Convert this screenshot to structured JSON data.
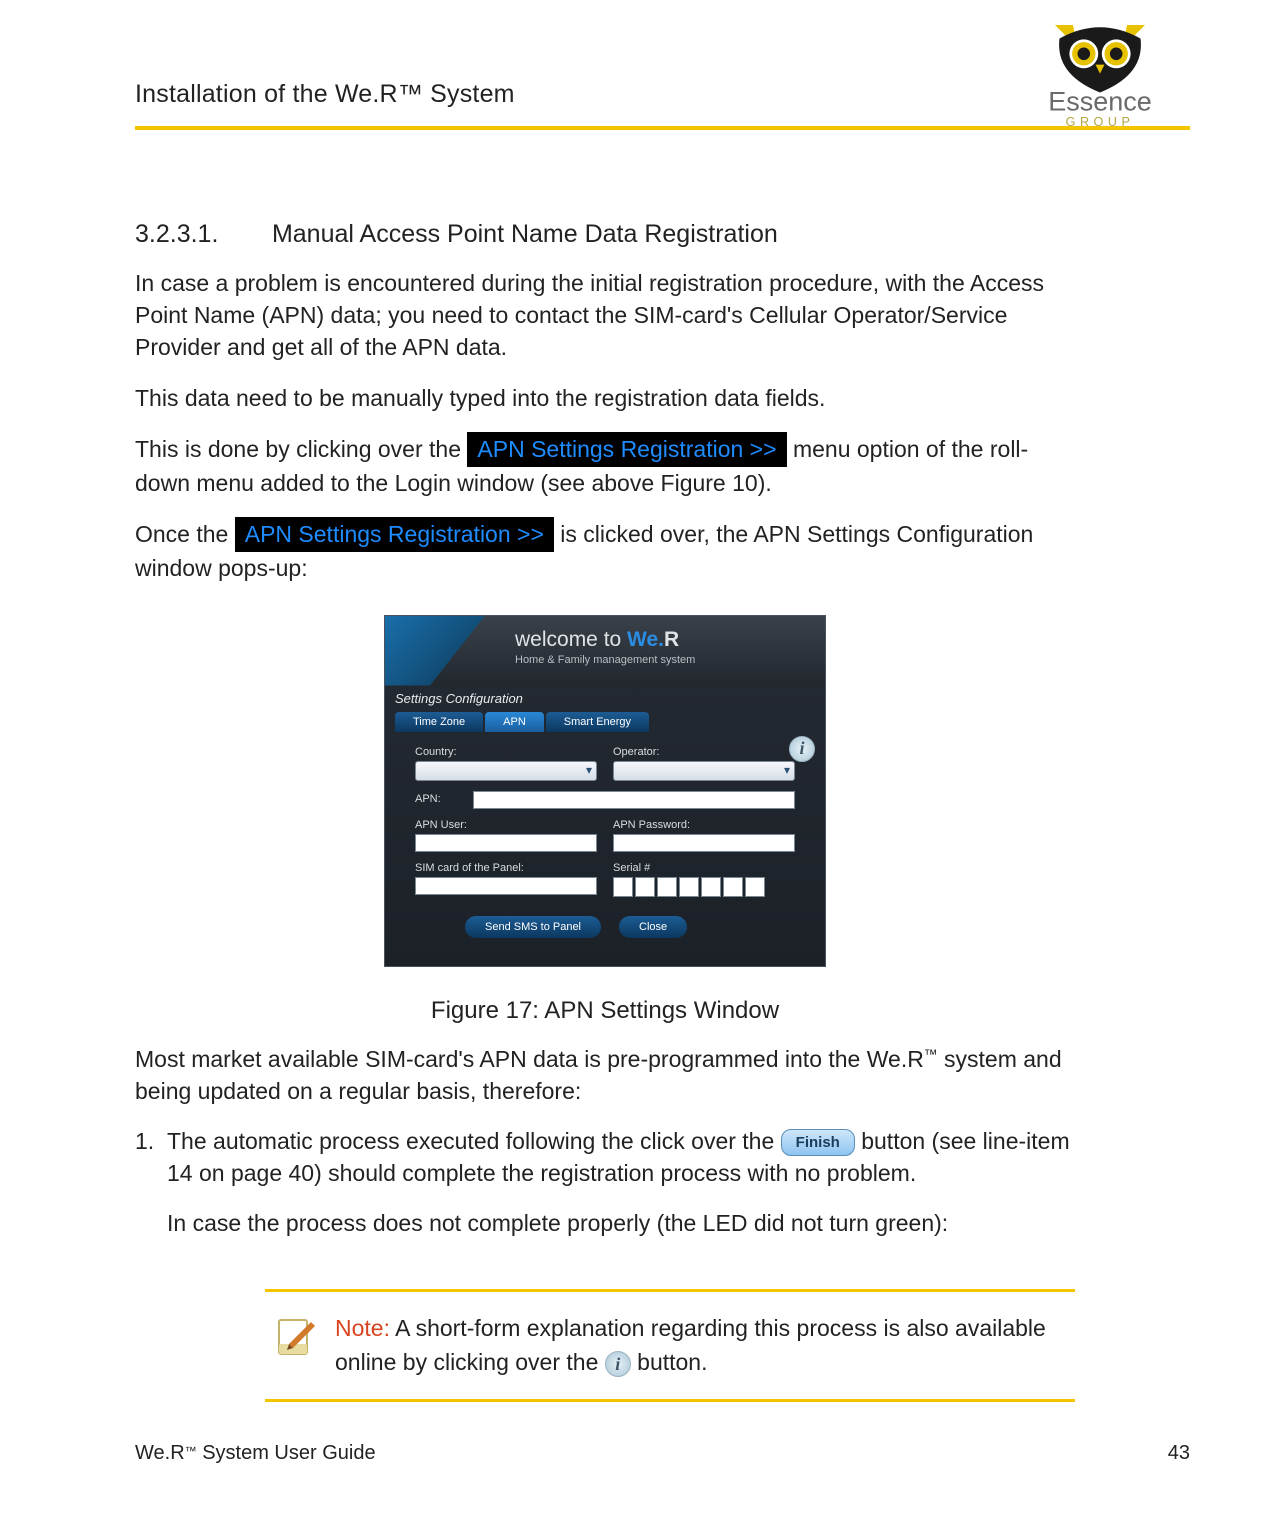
{
  "header": {
    "title": "Installation of the We.R™ System"
  },
  "logo": {
    "brand_top": "Essence",
    "brand_bottom": "GROUP"
  },
  "section": {
    "number": "3.2.3.1.",
    "title": "Manual Access Point Name Data Registration"
  },
  "p1": "In case a problem is encountered during the initial registration procedure, with the Access Point Name (APN) data; you need to contact the SIM-card's Cellular Operator/Service Provider and get all of the APN data.",
  "p2": "This data need to be manually typed into the registration data fields.",
  "p3a": "This is done by clicking over the ",
  "apn_label": " APN Settings Registration >> ",
  "p3b": " menu option of the roll-down menu added to the Login window (see above Figure 10).",
  "p4a": "Once the ",
  "p4b": " is clicked over, the APN Settings Configuration window pops-up:",
  "figure_caption": "Figure 17: APN Settings Window",
  "p5": "Most market available SIM-card's APN data is pre-programmed into the We.R",
  "p5_tm": "™",
  "p5_cont": " system and being updated on a regular basis, therefore:",
  "list1_num": "1.",
  "list1a": "The automatic process executed following the click over the ",
  "finish_label": "Finish",
  "list1b": " button (see line-item 14 on page 40) should complete the registration process with no problem.",
  "list1c": "In case the process does not complete properly (the LED did not turn green):",
  "note": {
    "label": "Note:",
    "text_a": " A short-form explanation regarding this process is also available online by clicking over the ",
    "text_b": " button."
  },
  "i_symbol": "i",
  "apn_window": {
    "welcome": "welcome to ",
    "brand_we": "We.",
    "brand_r": "R",
    "subtitle": "Home & Family management system",
    "settings_conf": "Settings Configuration",
    "tab_timezone": "Time Zone",
    "tab_apn": "APN",
    "tab_smart": "Smart Energy",
    "label_country": "Country:",
    "label_operator": "Operator:",
    "label_apn": "APN:",
    "label_apn_user": "APN User:",
    "label_apn_password": "APN Password:",
    "label_sim": "SIM card of the Panel:",
    "label_serial": "Serial #",
    "btn_send": "Send SMS to Panel",
    "btn_close": "Close"
  },
  "footer": {
    "left_a": "We.R",
    "left_tm": "™",
    "left_b": " System User Guide",
    "page": "43"
  }
}
